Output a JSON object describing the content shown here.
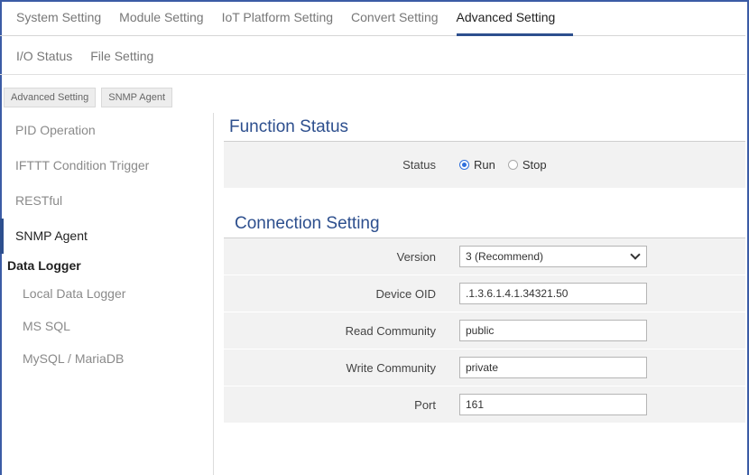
{
  "tabs_row1": [
    "System Setting",
    "Module Setting",
    "IoT Platform Setting",
    "Convert Setting",
    "Advanced Setting"
  ],
  "tabs_row2": [
    "I/O Status",
    "File Setting"
  ],
  "breadcrumb": [
    "Advanced Setting",
    "SNMP Agent"
  ],
  "sidebar": {
    "items": [
      "PID Operation",
      "IFTTT Condition Trigger",
      "RESTful",
      "SNMP Agent"
    ],
    "group": "Data Logger",
    "sub_items": [
      "Local Data Logger",
      "MS SQL",
      "MySQL / MariaDB"
    ]
  },
  "function_status": {
    "title": "Function Status",
    "status_label": "Status",
    "run_label": "Run",
    "stop_label": "Stop",
    "selected": "Run"
  },
  "connection": {
    "title": "Connection Setting",
    "version_label": "Version",
    "version_value": "3 (Recommend)",
    "device_oid_label": "Device OID",
    "device_oid_value": ".1.3.6.1.4.1.34321.50",
    "read_label": "Read Community",
    "read_value": "public",
    "write_label": "Write Community",
    "write_value": "private",
    "port_label": "Port",
    "port_value": "161"
  },
  "colors": {
    "accent": "#2d4f8e",
    "radio": "#2f6fdc",
    "row_bg": "#f2f2f2"
  }
}
